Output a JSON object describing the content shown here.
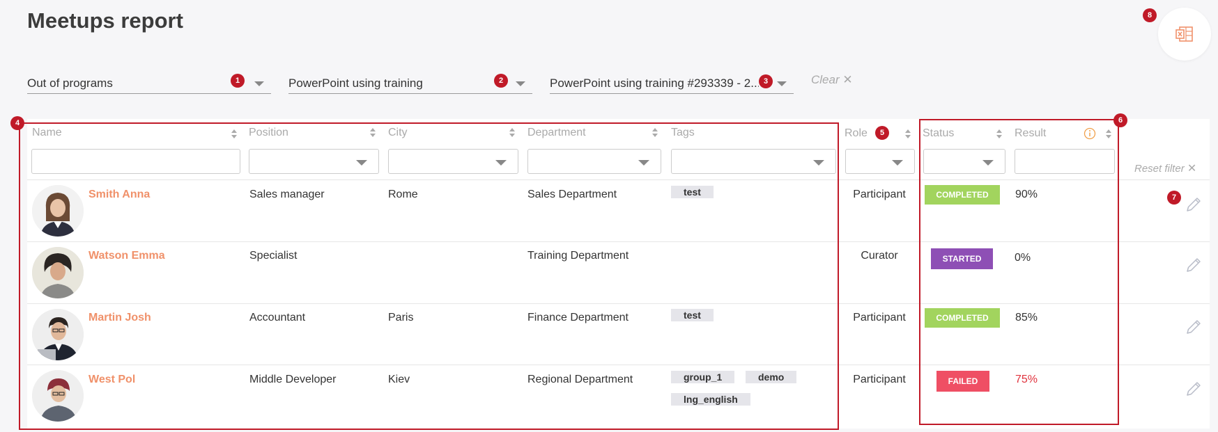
{
  "page": {
    "title": "Meetups report"
  },
  "filters": [
    {
      "value": "Out of programs"
    },
    {
      "value": "PowerPoint using training"
    },
    {
      "value": "PowerPoint using training #293339 - 2..."
    }
  ],
  "clear_label": "Clear",
  "columns": {
    "name": "Name",
    "position": "Position",
    "city": "City",
    "department": "Department",
    "tags": "Tags",
    "role": "Role",
    "status": "Status",
    "result": "Result"
  },
  "reset_filter_label": "Reset filter",
  "badges": [
    "1",
    "2",
    "3",
    "4",
    "5",
    "6",
    "7",
    "8"
  ],
  "rows": [
    {
      "name": "Smith Anna",
      "position": "Sales manager",
      "city": "Rome",
      "department": "Sales Department",
      "tags": [
        "test"
      ],
      "role": "Participant",
      "status": "COMPLETED",
      "result": "90%"
    },
    {
      "name": "Watson Emma",
      "position": "Specialist",
      "city": "",
      "department": "Training Department",
      "tags": [],
      "role": "Curator",
      "status": "STARTED",
      "result": "0%"
    },
    {
      "name": "Martin Josh",
      "position": "Accountant",
      "city": "Paris",
      "department": "Finance Department",
      "tags": [
        "test"
      ],
      "role": "Participant",
      "status": "COMPLETED",
      "result": "85%"
    },
    {
      "name": "West Pol",
      "position": "Middle Developer",
      "city": "Kiev",
      "department": "Regional Department",
      "tags": [
        "group_1",
        "demo",
        "lng_english"
      ],
      "role": "Participant",
      "status": "FAILED",
      "result": "75%"
    }
  ],
  "colors": {
    "accent_name": "#f0916a",
    "completed": "#a2d45e",
    "started": "#8e4fb5",
    "failed": "#ef4f64",
    "failed_result": "#e0323d",
    "annotation_red": "#c01a28",
    "export_icon": "#f0916a",
    "info_icon": "#f0a04b"
  },
  "icons": {
    "export": "excel-export-icon",
    "edit": "pencil-icon",
    "info": "info-circle-icon",
    "clear": "close-icon",
    "sort": "sort-arrows-icon",
    "dropdown": "chevron-down-icon"
  }
}
